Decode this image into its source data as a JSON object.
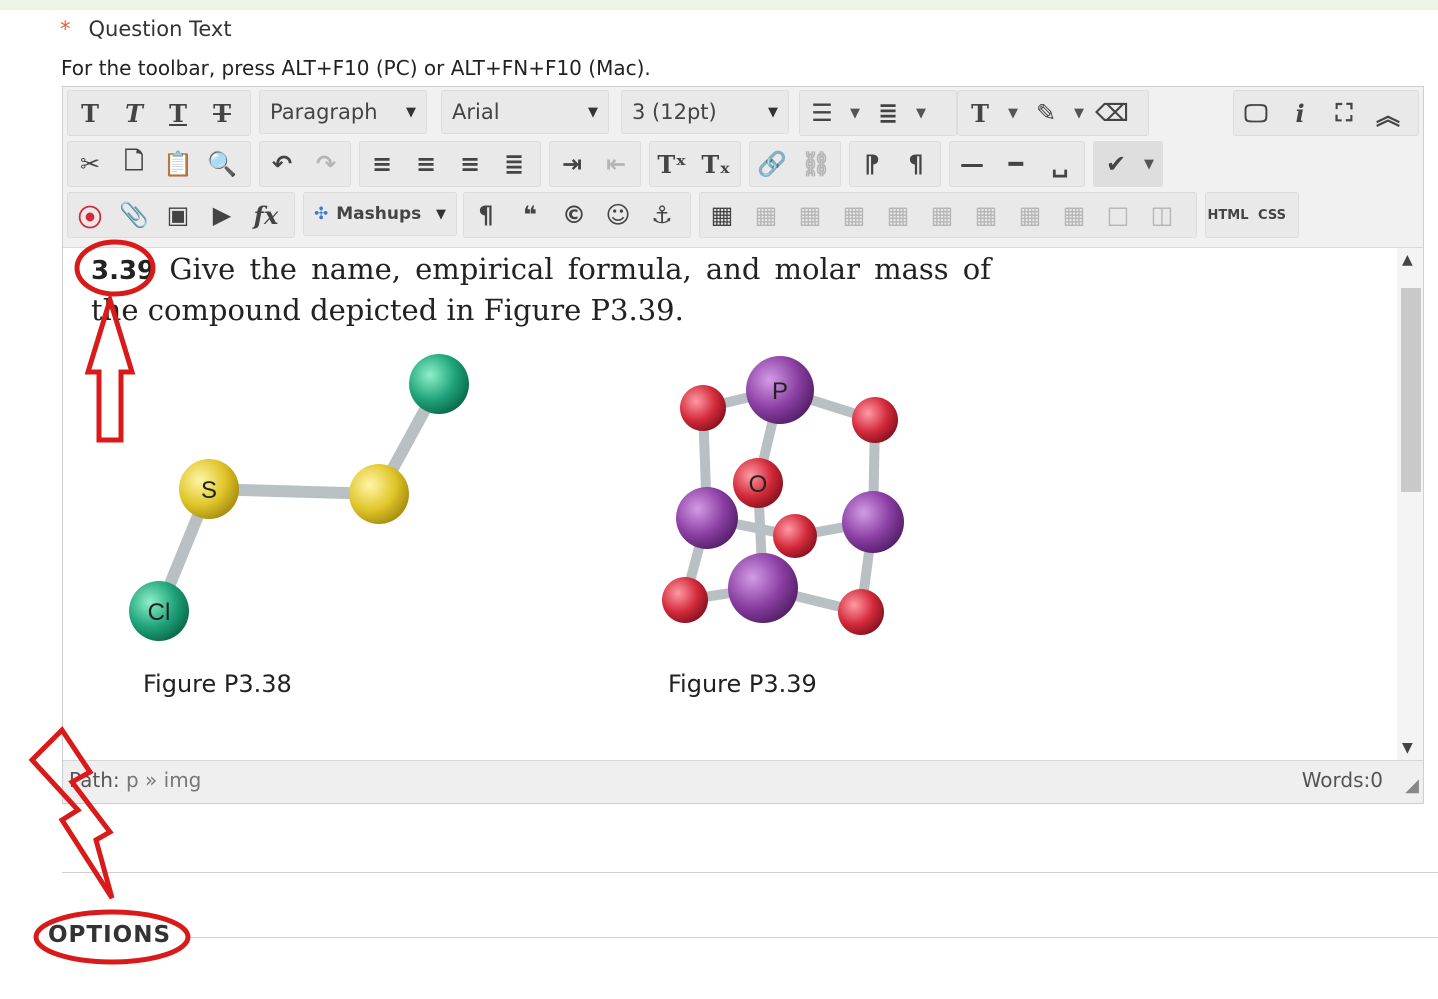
{
  "question": {
    "required_marker": "*",
    "label": "Question Text",
    "hint": "For the toolbar, press ALT+F10 (PC) or ALT+FN+F10 (Mac)."
  },
  "toolbar": {
    "format_select": "Paragraph",
    "font_select": "Arial",
    "size_select": "3 (12pt)",
    "mashups_label": "Mashups",
    "html_label": "HTML",
    "css_label": "CSS"
  },
  "content": {
    "problem_number": "3.39",
    "problem_text": "Give the name, empirical formula, and molar mass of the compound depicted in Figure P3.39.",
    "figure1": {
      "caption": "Figure P3.38",
      "atom_labels": [
        "S",
        "Cl"
      ]
    },
    "figure2": {
      "caption": "Figure P3.39",
      "atom_labels": [
        "P",
        "O"
      ]
    }
  },
  "statusbar": {
    "path_label": "Path:",
    "path_value": "p » img",
    "words_label": "Words:0"
  },
  "options_heading": "OPTIONS",
  "colors": {
    "required_star": "#d9632b",
    "annotation_red": "#d91a1a",
    "sulfur": "#e0c52a",
    "chlorine": "#1fa37a",
    "phosphorus": "#8b3fa3",
    "oxygen": "#d32a3a"
  }
}
